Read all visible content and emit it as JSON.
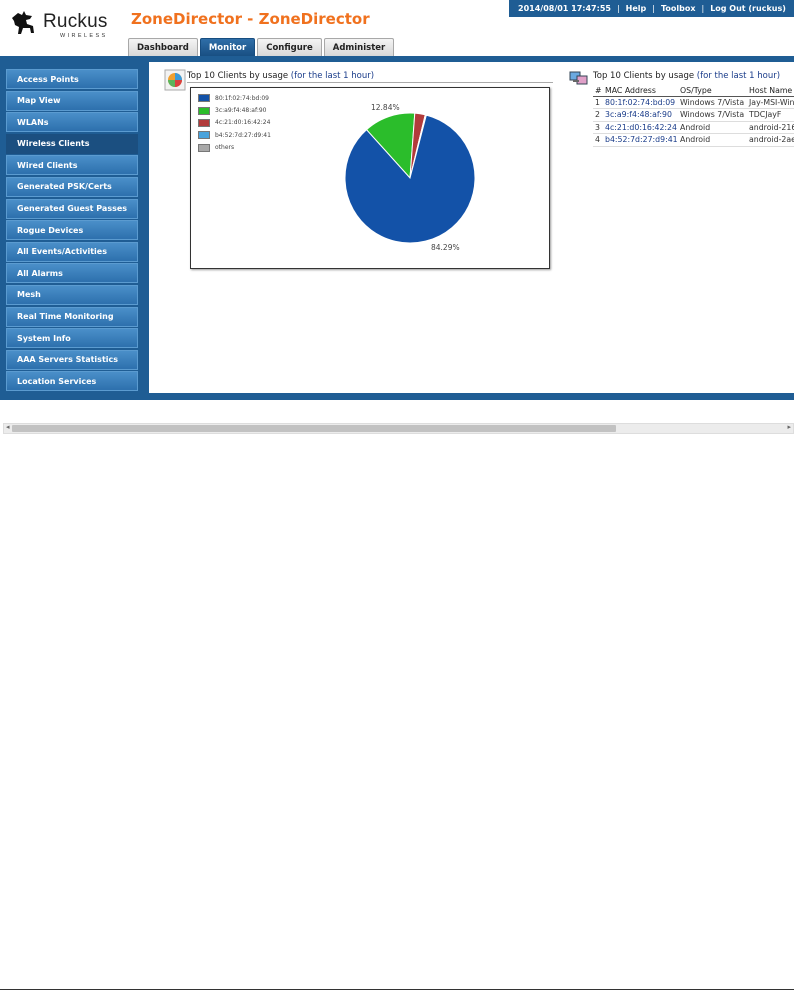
{
  "brand": {
    "name": "Ruckus",
    "tagline": "WIRELESS"
  },
  "app_title": "ZoneDirector - ZoneDirector",
  "topbar": {
    "datetime": "2014/08/01  17:47:55",
    "help": "Help",
    "toolbox": "Toolbox",
    "logout": "Log Out (ruckus)",
    "separator": "|"
  },
  "tabs": [
    {
      "label": "Dashboard",
      "active": false
    },
    {
      "label": "Monitor",
      "active": true
    },
    {
      "label": "Configure",
      "active": false
    },
    {
      "label": "Administer",
      "active": false
    }
  ],
  "sidebar": {
    "items": [
      {
        "label": "Access Points"
      },
      {
        "label": "Map View"
      },
      {
        "label": "WLANs"
      },
      {
        "label": "Wireless Clients",
        "active": true
      },
      {
        "label": "Wired Clients"
      },
      {
        "label": "Generated PSK/Certs"
      },
      {
        "label": "Generated Guest Passes"
      },
      {
        "label": "Rogue Devices"
      },
      {
        "label": "All Events/Activities"
      },
      {
        "label": "All Alarms"
      },
      {
        "label": "Mesh"
      },
      {
        "label": "Real Time Monitoring"
      },
      {
        "label": "System Info"
      },
      {
        "label": "AAA Servers Statistics"
      },
      {
        "label": "Location Services"
      }
    ]
  },
  "chart_panel": {
    "title_main": "Top 10 Clients by usage ",
    "title_range": "(for the last 1 hour)"
  },
  "table_panel": {
    "title_main": "Top 10 Clients by usage ",
    "title_range": "(for the last 1 hour)"
  },
  "chart_data": {
    "type": "pie",
    "legend": [
      {
        "label": "80:1f:02:74:bd:09",
        "color": "#1352a8"
      },
      {
        "label": "3c:a9:f4:48:af:90",
        "color": "#2bbd2b"
      },
      {
        "label": "4c:21:d0:16:42:24",
        "color": "#b23b3b"
      },
      {
        "label": "b4:52:7d:27:d9:41",
        "color": "#4aa3dc"
      },
      {
        "label": "others",
        "color": "#a9a9a9"
      }
    ],
    "slices": [
      {
        "label": "80:1f:02:74:bd:09",
        "value": 84.29,
        "color": "#1352a8",
        "data_label": "84.29%"
      },
      {
        "label": "3c:a9:f4:48:af:90",
        "value": 12.84,
        "color": "#2bbd2b",
        "data_label": "12.84%"
      },
      {
        "label": "4c:21:d0:16:42:24",
        "value": 2.6,
        "color": "#b23b3b",
        "data_label": ""
      },
      {
        "label": "b4:52:7d:27:d9:41",
        "value": 0.27,
        "color": "#4aa3dc",
        "data_label": ""
      }
    ]
  },
  "clients_table": {
    "headers": [
      "#",
      "MAC Address",
      "OS/Type",
      "Host Name"
    ],
    "rows": [
      {
        "num": "1",
        "mac": "80:1f:02:74:bd:09",
        "os": "Windows 7/Vista",
        "host": "Jay-MSI-Win"
      },
      {
        "num": "2",
        "mac": "3c:a9:f4:48:af:90",
        "os": "Windows 7/Vista",
        "host": "TDCJayF"
      },
      {
        "num": "3",
        "mac": "4c:21:d0:16:42:24",
        "os": "Android",
        "host": "android-216"
      },
      {
        "num": "4",
        "mac": "b4:52:7d:27:d9:41",
        "os": "Android",
        "host": "android-2ae"
      }
    ]
  },
  "colors": {
    "brand_orange": "#f0711e",
    "nav_blue": "#1f5d94",
    "link_blue": "#1a3c8a"
  },
  "icons": {
    "logo": "ruckus-dog-logo",
    "chart": "pie-chart-icon",
    "table": "clients-icon"
  }
}
